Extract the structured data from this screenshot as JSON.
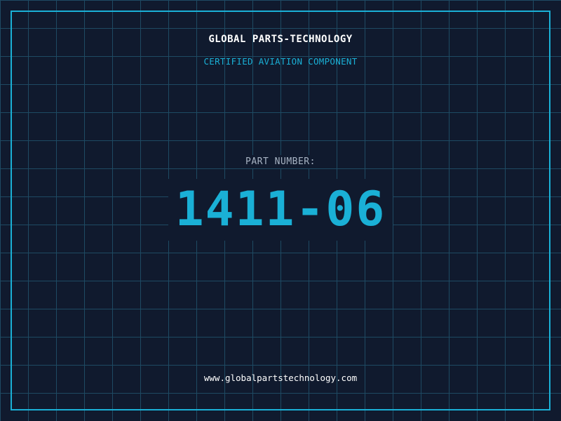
{
  "header": {
    "brand": "GLOBAL PARTS-TECHNOLOGY",
    "subtitle": "CERTIFIED AVIATION COMPONENT"
  },
  "part": {
    "label": "PART NUMBER:",
    "number": "1411-06"
  },
  "footer": {
    "url": "www.globalpartstechnology.com"
  },
  "colors": {
    "background": "#101a2e",
    "grid": "#1e4a63",
    "accent": "#1ab0d6",
    "text": "#ffffff",
    "muted": "#a8b4c4"
  }
}
